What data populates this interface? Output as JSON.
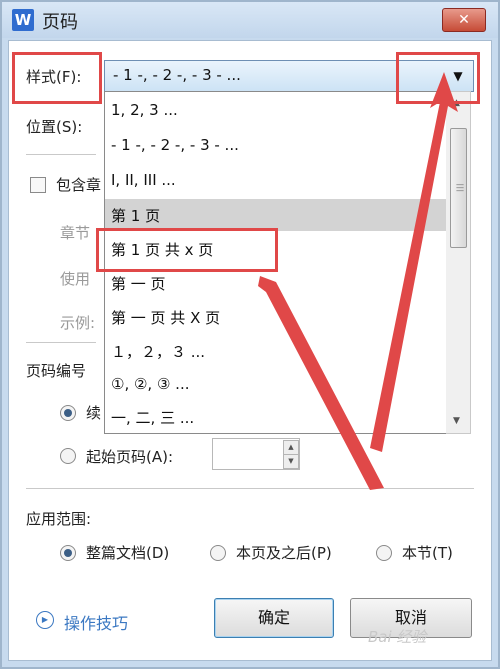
{
  "window": {
    "title": "页码",
    "app_icon": "W",
    "close_symbol": "✕"
  },
  "style_row": {
    "label": "样式(F):",
    "selected_value": "- 1 -, - 2 -, - 3 - ...",
    "arrow": "▼"
  },
  "position_row": {
    "label": "位置(S):"
  },
  "include_chapter": {
    "label": "包含章",
    "checked": false
  },
  "chapter_row": {
    "label": "章节"
  },
  "use_row": {
    "label": "使用"
  },
  "example_row": {
    "label": "示例:"
  },
  "numbering": {
    "header": "页码编号",
    "continue_label": "续",
    "continue_checked": true,
    "start_label": "起始页码(A):",
    "start_checked": false,
    "start_value": ""
  },
  "apply": {
    "header": "应用范围:",
    "options": [
      {
        "label": "整篇文档(D)",
        "checked": true
      },
      {
        "label": "本页及之后(P)",
        "checked": false
      },
      {
        "label": "本节(T)",
        "checked": false
      }
    ]
  },
  "tips": {
    "label": "操作技巧",
    "icon": "play-circle-icon"
  },
  "buttons": {
    "ok": "确定",
    "cancel": "取消"
  },
  "dropdown": {
    "items": [
      "1, 2, 3 ...",
      "- 1 -, - 2 -, - 3 - ...",
      "I, II, III ...",
      "第 1 页",
      "第 1 页 共 x 页",
      "第 一 页",
      "第 一 页 共 X 页",
      "１，２，３ ...",
      "①, ②, ③ ...",
      "一, 二, 三 ..."
    ],
    "highlighted_index": 3
  },
  "watermark": "Bai 经验",
  "colors": {
    "annotation": "#e04848",
    "accent_link": "#3b78c2",
    "title_bar": "#c7daee"
  }
}
